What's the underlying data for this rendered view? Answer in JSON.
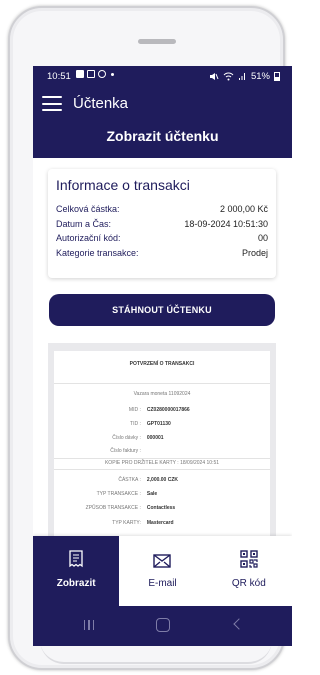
{
  "status_bar": {
    "time": "10:51",
    "battery": "51%"
  },
  "header": {
    "app_title": "Účtenka",
    "screen_title": "Zobrazit účtenku"
  },
  "transaction": {
    "title": "Informace o transakci",
    "rows": [
      {
        "label": "Celková částka:",
        "value": "2 000,00 Kč"
      },
      {
        "label": "Datum a Čas:",
        "value": "18-09-2024 10:51:30"
      },
      {
        "label": "Autorizační kód:",
        "value": "00"
      },
      {
        "label": "Kategorie transakce:",
        "value": "Prodej"
      }
    ]
  },
  "download_button": "STÁHNOUT ÚČTENKU",
  "receipt": {
    "title": "POTVRZENÍ O TRANSAKCI",
    "software": "Vazara moneta 11092024",
    "mid_label": "MID :",
    "mid": "CZ0280000017866",
    "tid_label": "TID :",
    "tid": "GPT01130",
    "doc_label": "Číslo dávky :",
    "doc": "000001",
    "invoice_label": "Číslo faktury :",
    "copy_line": "KOPIE PRO DRŽITELE KARTY : 18/09/2024 10:51",
    "amount_label": "ČÁSTKA :",
    "amount": "2,000.00 CZK",
    "type_label": "TYP TRANSAKCE :",
    "type": "Sale",
    "method_label": "ZPŮSOB TRANSAKCE :",
    "method": "Contactless",
    "card_label": "TYP KARTY:",
    "card": "Mastercard"
  },
  "nav": {
    "view": "Zobrazit",
    "email": "E-mail",
    "qr": "QR kód"
  },
  "colors": {
    "primary": "#1f1c5c",
    "background": "#ffffff"
  }
}
